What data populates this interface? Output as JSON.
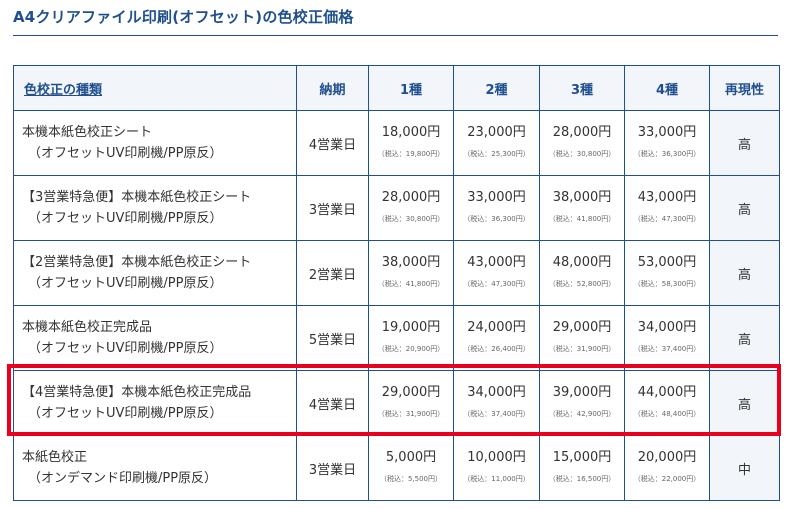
{
  "title": "A4クリアファイル印刷(オフセット)の色校正価格",
  "headers": {
    "type": "色校正の種類",
    "days": "納期",
    "col1": "1種",
    "col2": "2種",
    "col3": "3種",
    "col4": "4種",
    "repro": "再現性"
  },
  "rows": [
    {
      "name": "本機本紙色校正シート",
      "sub": "（オフセットUV印刷機/PP原反）",
      "days": "4営業日",
      "prices": [
        "18,000円",
        "23,000円",
        "28,000円",
        "33,000円"
      ],
      "taxes": [
        "（税込：19,800円）",
        "（税込：25,300円）",
        "（税込：30,800円）",
        "（税込：36,300円）"
      ],
      "repro": "高"
    },
    {
      "name": "【3営業特急便】本機本紙色校正シート",
      "sub": "（オフセットUV印刷機/PP原反）",
      "days": "3営業日",
      "prices": [
        "28,000円",
        "33,000円",
        "38,000円",
        "43,000円"
      ],
      "taxes": [
        "（税込：30,800円）",
        "（税込：36,300円）",
        "（税込：41,800円）",
        "（税込：47,300円）"
      ],
      "repro": "高"
    },
    {
      "name": "【2営業特急便】本機本紙色校正シート",
      "sub": "（オフセットUV印刷機/PP原反）",
      "days": "2営業日",
      "prices": [
        "38,000円",
        "43,000円",
        "48,000円",
        "53,000円"
      ],
      "taxes": [
        "（税込：41,800円）",
        "（税込：47,300円）",
        "（税込：52,800円）",
        "（税込：58,300円）"
      ],
      "repro": "高"
    },
    {
      "name": "本機本紙色校正完成品",
      "sub": "（オフセットUV印刷機/PP原反）",
      "days": "5営業日",
      "prices": [
        "19,000円",
        "24,000円",
        "29,000円",
        "34,000円"
      ],
      "taxes": [
        "（税込：20,900円）",
        "（税込：26,400円）",
        "（税込：31,900円）",
        "（税込：37,400円）"
      ],
      "repro": "高"
    },
    {
      "name": "【4営業特急便】本機本紙色校正完成品",
      "sub": "（オフセットUV印刷機/PP原反）",
      "days": "4営業日",
      "prices": [
        "29,000円",
        "34,000円",
        "39,000円",
        "44,000円"
      ],
      "taxes": [
        "（税込：31,900円）",
        "（税込：37,400円）",
        "（税込：42,900円）",
        "（税込：48,400円）"
      ],
      "repro": "高"
    },
    {
      "name": "本紙色校正",
      "sub": "（オンデマンド印刷機/PP原反）",
      "days": "3営業日",
      "prices": [
        "5,000円",
        "10,000円",
        "15,000円",
        "20,000円"
      ],
      "taxes": [
        "（税込：5,500円）",
        "（税込：11,000円）",
        "（税込：16,500円）",
        "（税込：22,000円）"
      ],
      "repro": "中"
    }
  ],
  "colors": {
    "accent": "#1f4f8f",
    "header_bg": "#f2f5f9",
    "highlight": "#e8001c"
  }
}
